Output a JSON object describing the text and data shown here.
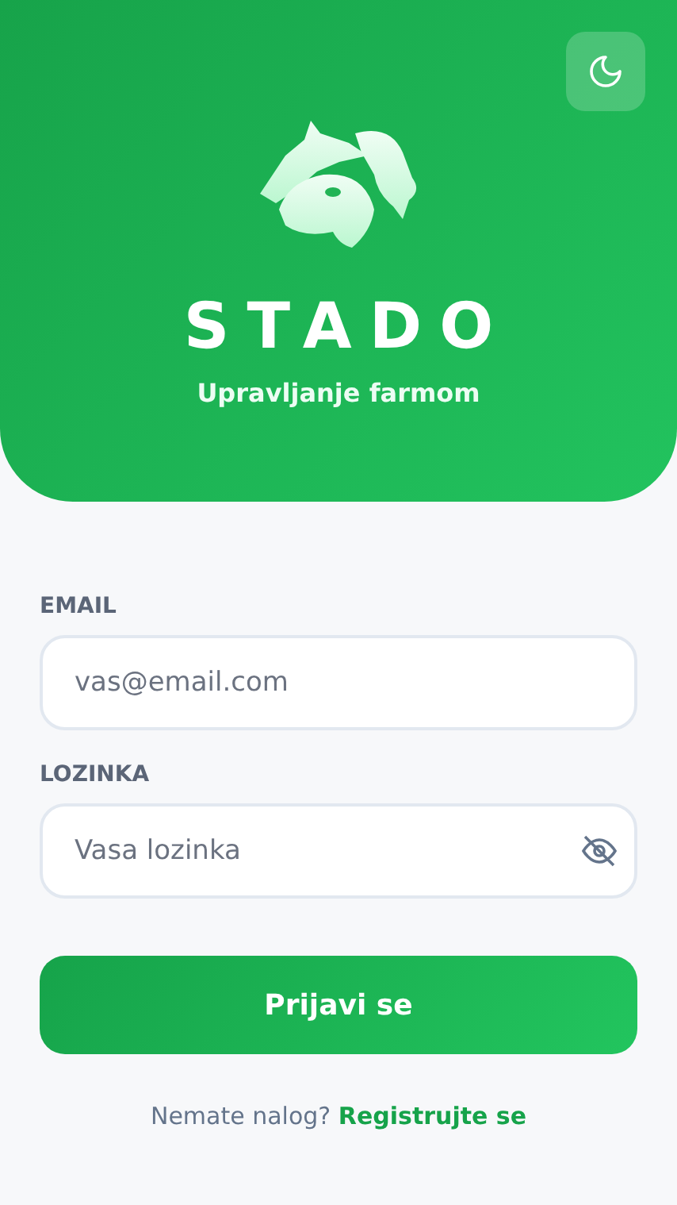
{
  "header": {
    "title": "STADO",
    "subtitle": "Upravljanje farmom"
  },
  "form": {
    "fields": [
      {
        "label": "EMAIL",
        "placeholder": "vas@email.com",
        "kind": "email"
      },
      {
        "label": "LOZINKA",
        "placeholder": "Vasa lozinka",
        "kind": "password"
      }
    ],
    "submit": "Prijavi se",
    "prompt": "Nemate nalog?",
    "link": "Registrujte se"
  }
}
